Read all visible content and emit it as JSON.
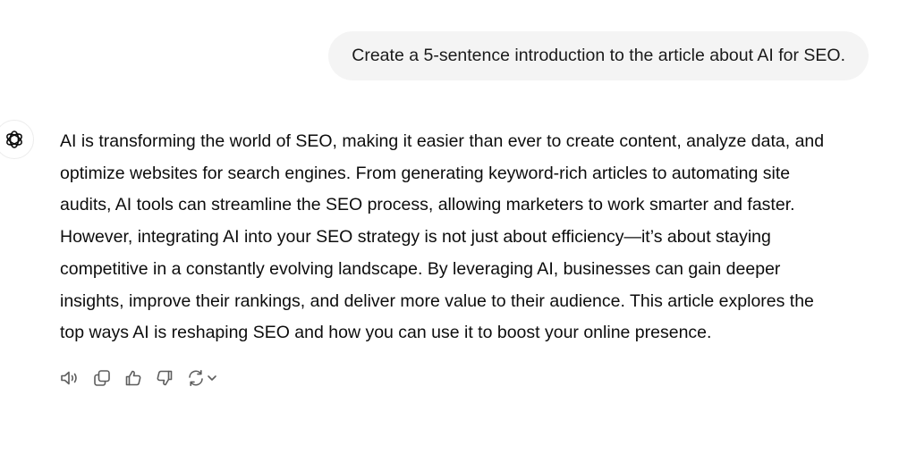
{
  "conversation": {
    "user_message": "Create a 5-sentence introduction to the article about AI for SEO.",
    "assistant": {
      "avatar_icon": "chatgpt-logo-icon",
      "response": "AI is transforming the world of SEO, making it easier than ever to create content, analyze data, and\noptimize websites for search engines. From generating keyword-rich articles to automating site\naudits, AI tools can streamline the SEO process, allowing marketers to work smarter and faster.\nHowever, integrating AI into your SEO strategy is not just about efficiency—it’s about staying\ncompetitive in a constantly evolving landscape. By leveraging AI, businesses can gain deeper\ninsights, improve their rankings, and deliver more value to their audience. This article explores the\ntop ways AI is reshaping SEO and how you can use it to boost your online presence."
    },
    "actions": [
      {
        "icon": "speaker-icon"
      },
      {
        "icon": "copy-icon"
      },
      {
        "icon": "thumbs-up-icon"
      },
      {
        "icon": "thumbs-down-icon"
      },
      {
        "icon": "regenerate-icon",
        "menu_icon": "chevron-down-icon"
      }
    ]
  },
  "colors": {
    "user_bubble_bg": "#f4f4f4",
    "text": "#0d0d0d",
    "icon": "#5d5d5d"
  }
}
